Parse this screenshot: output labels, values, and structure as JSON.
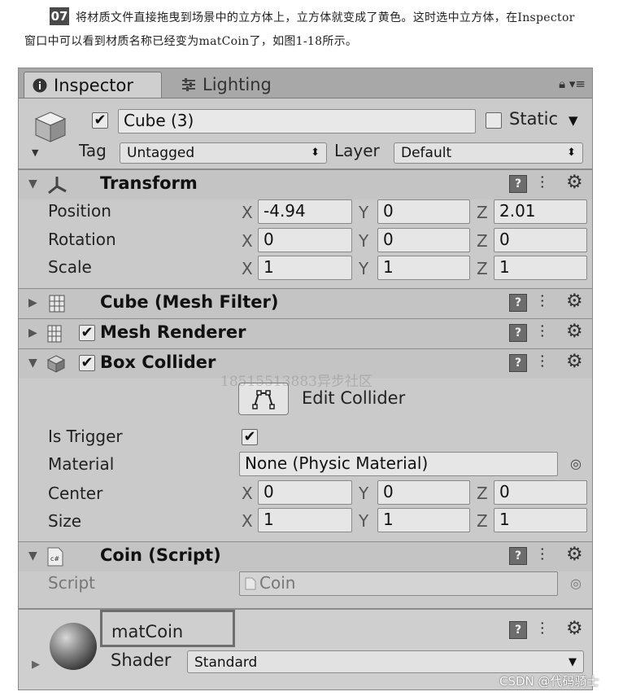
{
  "doc": {
    "step_number": "07",
    "line1": "将材质文件直接拖曳到场景中的立方体上，立方体就变成了黄色。这时选中立方体，在Inspector",
    "line2": "窗口中可以看到材质名称已经变为matCoin了，如图1-18所示。"
  },
  "tabs": {
    "inspector": "Inspector",
    "lighting": "Lighting"
  },
  "object": {
    "name": "Cube (3)",
    "active": true,
    "static_label": "Static",
    "tag_label": "Tag",
    "tag_value": "Untagged",
    "layer_label": "Layer",
    "layer_value": "Default"
  },
  "transform": {
    "title": "Transform",
    "position_label": "Position",
    "rotation_label": "Rotation",
    "scale_label": "Scale",
    "position": {
      "x": "-4.94",
      "y": "0",
      "z": "2.01"
    },
    "rotation": {
      "x": "0",
      "y": "0",
      "z": "0"
    },
    "scale": {
      "x": "1",
      "y": "1",
      "z": "1"
    }
  },
  "axis": {
    "x": "X",
    "y": "Y",
    "z": "Z"
  },
  "mesh_filter": {
    "title": "Cube (Mesh Filter)"
  },
  "mesh_renderer": {
    "title": "Mesh Renderer"
  },
  "box_collider": {
    "title": "Box Collider",
    "edit_collider": "Edit Collider",
    "is_trigger_label": "Is Trigger",
    "material_label": "Material",
    "material_value": "None (Physic Material)",
    "center_label": "Center",
    "size_label": "Size",
    "center": {
      "x": "0",
      "y": "0",
      "z": "0"
    },
    "size": {
      "x": "1",
      "y": "1",
      "z": "1"
    }
  },
  "coin_script": {
    "title": "Coin (Script)",
    "script_label": "Script",
    "script_value": "Coin"
  },
  "material": {
    "name": "matCoin",
    "shader_label": "Shader",
    "shader_value": "Standard"
  },
  "watermark": "18515513883异步社区",
  "csdn": "CSDN @代码骑士"
}
